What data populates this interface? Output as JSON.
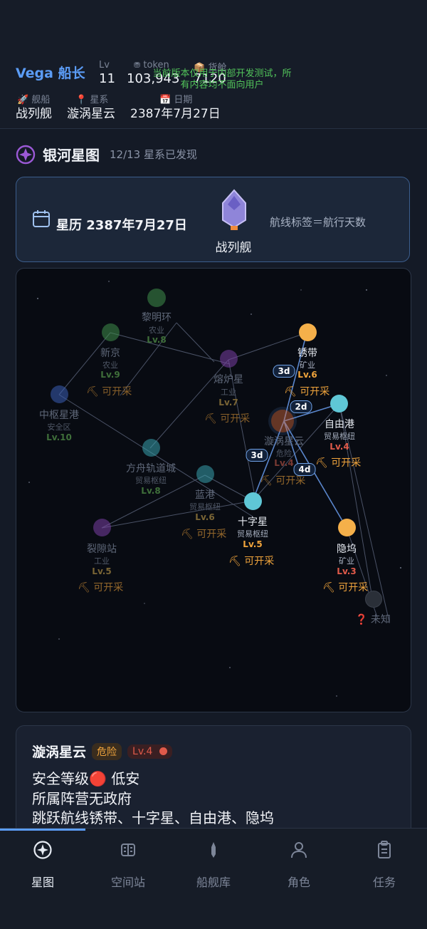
{
  "header": {
    "captain": "Vega 船长",
    "stats": [
      {
        "label": "Lv",
        "value": "11"
      },
      {
        "label": "token",
        "value": "103,943"
      },
      {
        "label": "货舱",
        "value": "7120"
      }
    ],
    "info": [
      {
        "label": "舰船",
        "value": "战列舰"
      },
      {
        "label": "星系",
        "value": "漩涡星云"
      },
      {
        "label": "日期",
        "value": "2387年7月27日"
      }
    ],
    "dev_notice": "当前版本仅用于内部开发测试，所有内容均不面向用户"
  },
  "section": {
    "title": "银河星图",
    "subtitle": "12/13 星系已发现"
  },
  "status_card": {
    "calendar_label": "星历 2387年7月27日",
    "ship": "战列舰",
    "route_hint": "航线标签＝航行天数"
  },
  "map": {
    "nodes": [
      {
        "name": "黎明环",
        "type": "农业",
        "level": "Lv.8",
        "color": "#3f8f4a",
        "dim": true,
        "mine": false
      },
      {
        "name": "新京",
        "type": "农业",
        "level": "Lv.9",
        "color": "#3f8f4a",
        "dim": true,
        "mine": true
      },
      {
        "name": "熔炉星",
        "type": "工业",
        "level": "Lv.7",
        "color": "#7a3fa4",
        "dim": true,
        "mine": true
      },
      {
        "name": "锈带",
        "type": "矿业",
        "level": "Lv.6",
        "color": "#f5b04a",
        "dim": false,
        "mine": true
      },
      {
        "name": "中枢星港",
        "type": "安全区",
        "level": "Lv.10",
        "color": "#3a5fb4",
        "dim": true,
        "mine": false
      },
      {
        "name": "自由港",
        "type": "贸易枢纽",
        "level": "Lv.4",
        "color": "#5fc7d6",
        "dim": false,
        "mine": true
      },
      {
        "name": "漩涡星云",
        "type": "危险",
        "level": "Lv.4",
        "color": "#d66a3c",
        "dim": true,
        "mine": true
      },
      {
        "name": "方舟轨道城",
        "type": "贸易枢纽",
        "level": "Lv.8",
        "color": "#39a2ad",
        "dim": true,
        "mine": false
      },
      {
        "name": "蓝港",
        "type": "贸易枢纽",
        "level": "Lv.6",
        "color": "#39a2ad",
        "dim": true,
        "mine": true
      },
      {
        "name": "十字星",
        "type": "贸易枢纽",
        "level": "Lv.5",
        "color": "#5fc7d6",
        "dim": false,
        "mine": true
      },
      {
        "name": "裂隙站",
        "type": "工业",
        "level": "Lv.5",
        "color": "#7a3fa4",
        "dim": true,
        "mine": true
      },
      {
        "name": "隐坞",
        "type": "矿业",
        "level": "Lv.3",
        "color": "#f5b04a",
        "dim": false,
        "mine": true
      },
      {
        "name": "未知",
        "type": "",
        "level": "",
        "color": "#3a3f4a",
        "dim": true,
        "mine": false
      }
    ],
    "mine_label": "可开采",
    "routes": [
      "3d",
      "2d",
      "3d",
      "4d"
    ]
  },
  "detail": {
    "name": "漩涡星云",
    "danger_tag": "危险",
    "level_tag": "Lv.4",
    "lines": [
      "安全等级🔴 低安",
      "所属阵营无政府",
      "跳跃航线锈带、十字星、自由港、隐坞"
    ]
  },
  "tabs": [
    {
      "label": "星图",
      "icon": "compass-icon",
      "active": true
    },
    {
      "label": "空间站",
      "icon": "station-icon",
      "active": false
    },
    {
      "label": "船舰库",
      "icon": "ship-icon",
      "active": false
    },
    {
      "label": "角色",
      "icon": "user-icon",
      "active": false
    },
    {
      "label": "任务",
      "icon": "clipboard-icon",
      "active": false
    }
  ],
  "colors": {
    "accent": "#5b9cf6",
    "mine": "#f0a43c",
    "danger": "#e05a4a",
    "good": "#52c45a"
  }
}
